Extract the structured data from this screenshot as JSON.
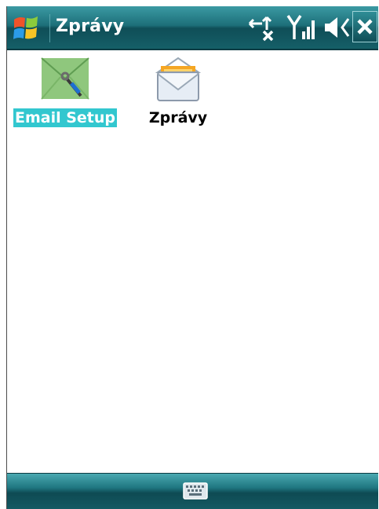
{
  "titlebar": {
    "title": "Zprávy",
    "icons": [
      "windows-start-icon",
      "connectivity-icon",
      "signal-strength-icon",
      "volume-muted-icon",
      "close-icon"
    ]
  },
  "content": {
    "items": [
      {
        "label": "Email Setup",
        "icon": "email-setup-icon",
        "selected": true
      },
      {
        "label": "Zprávy",
        "icon": "envelope-icon",
        "selected": false
      }
    ]
  },
  "bottombar": {
    "icon": "keyboard-icon"
  },
  "colors": {
    "titlebar": "#1d6f79",
    "selection": "#32c7cf",
    "bottombar": "#1f7680"
  }
}
